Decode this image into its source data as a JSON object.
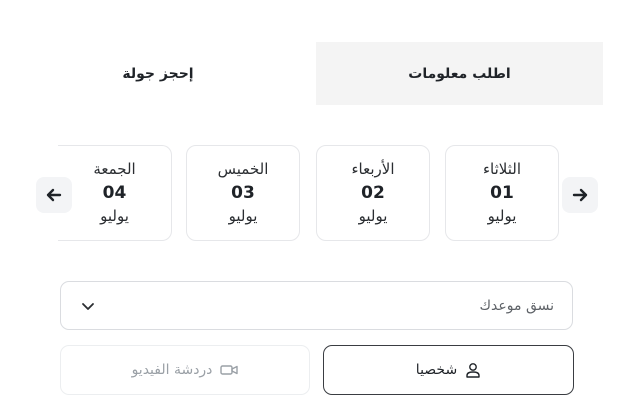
{
  "tabs": {
    "tour": "إحجز جولة",
    "info": "اطلب معلومات"
  },
  "days": [
    {
      "name": "الثلاثاء",
      "num": "01",
      "month": "يوليو"
    },
    {
      "name": "الأربعاء",
      "num": "02",
      "month": "يوليو"
    },
    {
      "name": "الخميس",
      "num": "03",
      "month": "يوليو"
    },
    {
      "name": "الجمعة",
      "num": "04",
      "month": "يوليو"
    }
  ],
  "nav": {
    "prev_icon": "arrow-left-icon",
    "next_icon": "arrow-right-icon"
  },
  "format_select": {
    "label": "نسق موعدك",
    "icon": "chevron-down-icon"
  },
  "options": {
    "person_label": "شخصيا",
    "person_icon": "user-icon",
    "video_label": "دردشة الفيديو",
    "video_icon": "video-camera-icon"
  },
  "colors": {
    "active_tab_bg": "#ffffff",
    "inactive_tab_bg": "#f4f4f4",
    "selected_border": "#3a3d42"
  }
}
